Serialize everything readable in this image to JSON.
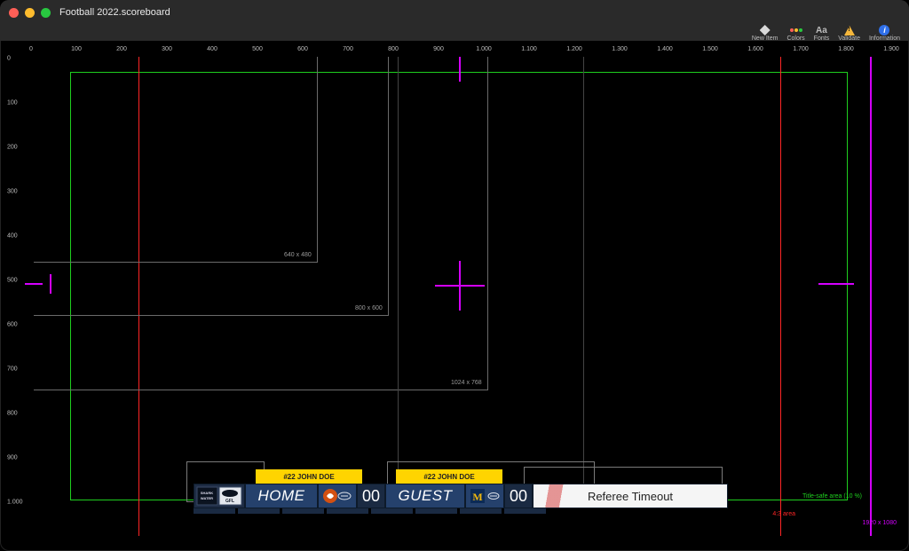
{
  "window": {
    "title": "Football 2022.scoreboard"
  },
  "toolbar": {
    "new_item": "New Item",
    "colors": "Colors",
    "fonts": "Fonts",
    "validate": "Validate",
    "information": "Information"
  },
  "ruler": {
    "top": [
      "0",
      "100",
      "200",
      "300",
      "400",
      "500",
      "600",
      "700",
      "800",
      "900",
      "1.000",
      "1.100",
      "1.200",
      "1.300",
      "1.400",
      "1.500",
      "1.600",
      "1.700",
      "1.800",
      "1.900"
    ],
    "left": [
      "0",
      "100",
      "200",
      "300",
      "400",
      "500",
      "600",
      "700",
      "800",
      "900",
      "1.000"
    ]
  },
  "guides": {
    "size_640": "640 x 480",
    "size_800": "800 x 600",
    "size_1024": "1024 x 768",
    "title_safe": "Title-safe area (10 %)",
    "area_43": "4:3 area",
    "res_1920": "1920 x 1080"
  },
  "scoreboard": {
    "home_tag": "#22 JOHN DOE",
    "guest_tag": "#22 JOHN DOE",
    "home_label": "HOME",
    "guest_label": "GUEST",
    "home_score": "00",
    "guest_score": "00",
    "banner": "Referee Timeout",
    "sponsor1": "SHARK WATER",
    "sponsor2": "GFL"
  }
}
